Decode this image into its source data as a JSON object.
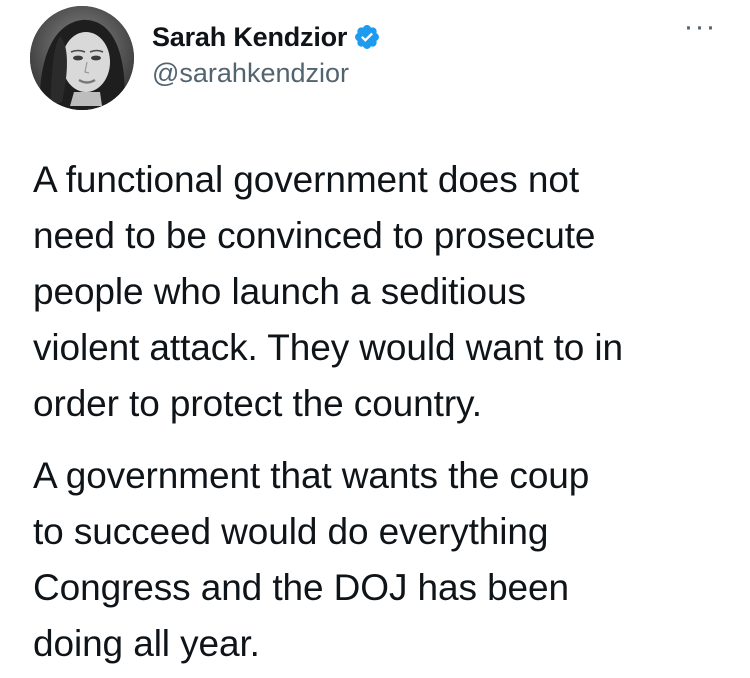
{
  "author": {
    "display_name": "Sarah Kendzior",
    "handle": "@sarahkendzior",
    "verified": true,
    "verified_color": "#1d9bf0"
  },
  "menu": {
    "more_label": "···"
  },
  "tweet": {
    "paragraphs": [
      {
        "lines": [
          "A functional government does not",
          "need to be convinced to prosecute",
          "people who launch a seditious",
          "violent attack. They would want to in",
          "order to protect the country."
        ]
      },
      {
        "lines": [
          "A government that wants the coup",
          "to succeed would do everything",
          "Congress and the DOJ has been",
          "doing all year."
        ]
      }
    ]
  }
}
